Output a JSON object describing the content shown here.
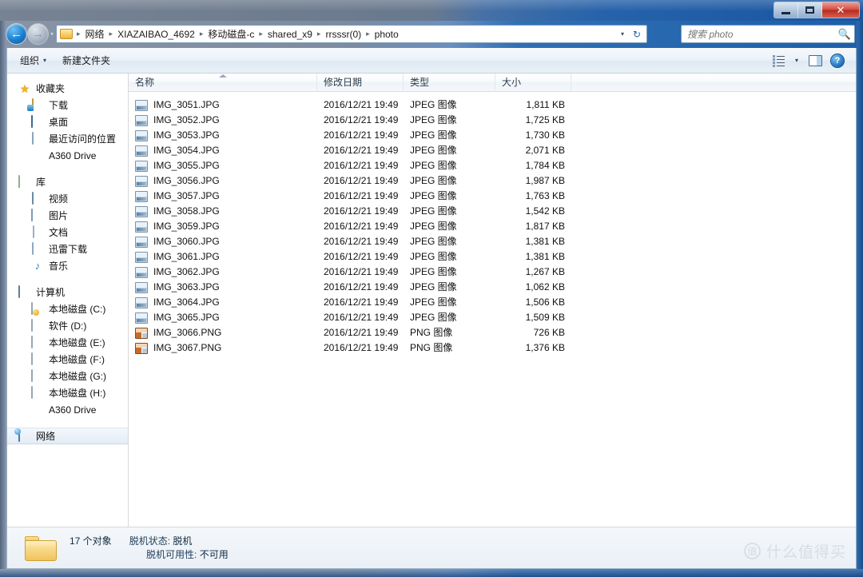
{
  "window": {
    "controls": {
      "minimize": "–",
      "maximize": "□",
      "close": "✕"
    }
  },
  "address": {
    "back_label": "←",
    "forward_label": "→",
    "dropdown_label": "▾",
    "folder_icon": "folder-icon",
    "crumbs": [
      "网络",
      "XIAZAIBAO_4692",
      "移动磁盘-c",
      "shared_x9",
      "rrsssr(0)",
      "photo"
    ],
    "separator": "▸",
    "history_caret": "▾",
    "refresh_label": "↻"
  },
  "search": {
    "placeholder": "搜索 photo",
    "value": "",
    "icon": "search-icon"
  },
  "toolbar": {
    "organize_label": "组织",
    "organize_caret": "▾",
    "new_folder_label": "新建文件夹",
    "view_icon": "view-options-icon",
    "view_caret": "▾",
    "preview_pane_icon": "preview-pane-icon",
    "help_icon": "help-icon",
    "help_glyph": "?"
  },
  "sidebar": {
    "groups": [
      {
        "root": {
          "label": "收藏夹",
          "icon": "star-icon"
        },
        "items": [
          {
            "label": "下载",
            "icon": "downloads-icon"
          },
          {
            "label": "桌面",
            "icon": "desktop-icon"
          },
          {
            "label": "最近访问的位置",
            "icon": "recent-places-icon"
          },
          {
            "label": "A360 Drive",
            "icon": "a360-drive-icon"
          }
        ]
      },
      {
        "root": {
          "label": "库",
          "icon": "library-icon"
        },
        "items": [
          {
            "label": "视频",
            "icon": "videos-icon"
          },
          {
            "label": "图片",
            "icon": "pictures-icon"
          },
          {
            "label": "文档",
            "icon": "documents-icon"
          },
          {
            "label": "迅雷下载",
            "icon": "thunder-download-icon"
          },
          {
            "label": "音乐",
            "icon": "music-icon"
          }
        ]
      },
      {
        "root": {
          "label": "计算机",
          "icon": "computer-icon"
        },
        "items": [
          {
            "label": "本地磁盘 (C:)",
            "icon": "system-drive-icon"
          },
          {
            "label": "软件 (D:)",
            "icon": "drive-icon"
          },
          {
            "label": "本地磁盘 (E:)",
            "icon": "drive-icon"
          },
          {
            "label": "本地磁盘 (F:)",
            "icon": "drive-icon"
          },
          {
            "label": "本地磁盘 (G:)",
            "icon": "drive-icon"
          },
          {
            "label": "本地磁盘 (H:)",
            "icon": "drive-icon"
          },
          {
            "label": "A360 Drive",
            "icon": "a360-drive-icon"
          }
        ]
      },
      {
        "root": {
          "label": "网络",
          "icon": "network-icon",
          "highlighted": true
        },
        "items": []
      }
    ]
  },
  "filelist": {
    "columns": [
      {
        "key": "name",
        "label": "名称",
        "sorted": "asc"
      },
      {
        "key": "date",
        "label": "修改日期",
        "sorted": ""
      },
      {
        "key": "type",
        "label": "类型",
        "sorted": ""
      },
      {
        "key": "size",
        "label": "大小",
        "sorted": ""
      }
    ],
    "rows": [
      {
        "name": "IMG_3051.JPG",
        "date": "2016/12/21 19:49",
        "type": "JPEG 图像",
        "size": "1,811 KB",
        "icon": "jpg"
      },
      {
        "name": "IMG_3052.JPG",
        "date": "2016/12/21 19:49",
        "type": "JPEG 图像",
        "size": "1,725 KB",
        "icon": "jpg"
      },
      {
        "name": "IMG_3053.JPG",
        "date": "2016/12/21 19:49",
        "type": "JPEG 图像",
        "size": "1,730 KB",
        "icon": "jpg"
      },
      {
        "name": "IMG_3054.JPG",
        "date": "2016/12/21 19:49",
        "type": "JPEG 图像",
        "size": "2,071 KB",
        "icon": "jpg"
      },
      {
        "name": "IMG_3055.JPG",
        "date": "2016/12/21 19:49",
        "type": "JPEG 图像",
        "size": "1,784 KB",
        "icon": "jpg"
      },
      {
        "name": "IMG_3056.JPG",
        "date": "2016/12/21 19:49",
        "type": "JPEG 图像",
        "size": "1,987 KB",
        "icon": "jpg"
      },
      {
        "name": "IMG_3057.JPG",
        "date": "2016/12/21 19:49",
        "type": "JPEG 图像",
        "size": "1,763 KB",
        "icon": "jpg"
      },
      {
        "name": "IMG_3058.JPG",
        "date": "2016/12/21 19:49",
        "type": "JPEG 图像",
        "size": "1,542 KB",
        "icon": "jpg"
      },
      {
        "name": "IMG_3059.JPG",
        "date": "2016/12/21 19:49",
        "type": "JPEG 图像",
        "size": "1,817 KB",
        "icon": "jpg"
      },
      {
        "name": "IMG_3060.JPG",
        "date": "2016/12/21 19:49",
        "type": "JPEG 图像",
        "size": "1,381 KB",
        "icon": "jpg"
      },
      {
        "name": "IMG_3061.JPG",
        "date": "2016/12/21 19:49",
        "type": "JPEG 图像",
        "size": "1,381 KB",
        "icon": "jpg"
      },
      {
        "name": "IMG_3062.JPG",
        "date": "2016/12/21 19:49",
        "type": "JPEG 图像",
        "size": "1,267 KB",
        "icon": "jpg"
      },
      {
        "name": "IMG_3063.JPG",
        "date": "2016/12/21 19:49",
        "type": "JPEG 图像",
        "size": "1,062 KB",
        "icon": "jpg"
      },
      {
        "name": "IMG_3064.JPG",
        "date": "2016/12/21 19:49",
        "type": "JPEG 图像",
        "size": "1,506 KB",
        "icon": "jpg"
      },
      {
        "name": "IMG_3065.JPG",
        "date": "2016/12/21 19:49",
        "type": "JPEG 图像",
        "size": "1,509 KB",
        "icon": "jpg"
      },
      {
        "name": "IMG_3066.PNG",
        "date": "2016/12/21 19:49",
        "type": "PNG 图像",
        "size": "726 KB",
        "icon": "png"
      },
      {
        "name": "IMG_3067.PNG",
        "date": "2016/12/21 19:49",
        "type": "PNG 图像",
        "size": "1,376 KB",
        "icon": "png"
      }
    ]
  },
  "statusbar": {
    "folder_icon": "folder-icon",
    "item_count": "17 个对象",
    "offline_status_label": "脱机状态:",
    "offline_status_value": "脱机",
    "offline_availability_label": "脱机可用性:",
    "offline_availability_value": "不可用"
  },
  "watermark": {
    "badge": "值",
    "text": "什么值得买"
  }
}
